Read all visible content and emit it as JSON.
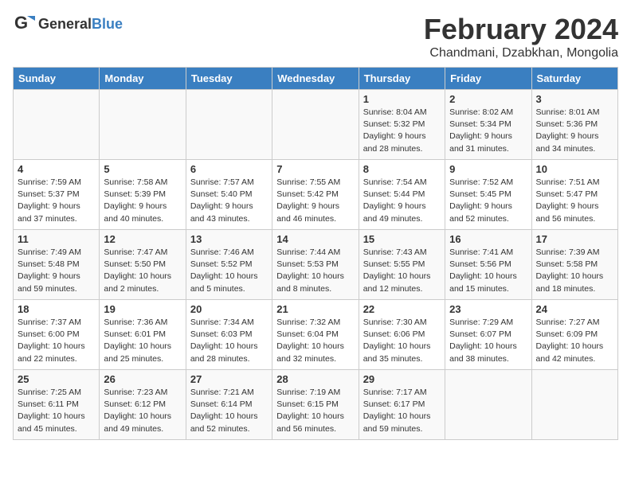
{
  "header": {
    "logo_general": "General",
    "logo_blue": "Blue",
    "main_title": "February 2024",
    "subtitle": "Chandmani, Dzabkhan, Mongolia"
  },
  "days_of_week": [
    "Sunday",
    "Monday",
    "Tuesday",
    "Wednesday",
    "Thursday",
    "Friday",
    "Saturday"
  ],
  "weeks": [
    [
      {
        "day": "",
        "info": ""
      },
      {
        "day": "",
        "info": ""
      },
      {
        "day": "",
        "info": ""
      },
      {
        "day": "",
        "info": ""
      },
      {
        "day": "1",
        "info": "Sunrise: 8:04 AM\nSunset: 5:32 PM\nDaylight: 9 hours\nand 28 minutes."
      },
      {
        "day": "2",
        "info": "Sunrise: 8:02 AM\nSunset: 5:34 PM\nDaylight: 9 hours\nand 31 minutes."
      },
      {
        "day": "3",
        "info": "Sunrise: 8:01 AM\nSunset: 5:36 PM\nDaylight: 9 hours\nand 34 minutes."
      }
    ],
    [
      {
        "day": "4",
        "info": "Sunrise: 7:59 AM\nSunset: 5:37 PM\nDaylight: 9 hours\nand 37 minutes."
      },
      {
        "day": "5",
        "info": "Sunrise: 7:58 AM\nSunset: 5:39 PM\nDaylight: 9 hours\nand 40 minutes."
      },
      {
        "day": "6",
        "info": "Sunrise: 7:57 AM\nSunset: 5:40 PM\nDaylight: 9 hours\nand 43 minutes."
      },
      {
        "day": "7",
        "info": "Sunrise: 7:55 AM\nSunset: 5:42 PM\nDaylight: 9 hours\nand 46 minutes."
      },
      {
        "day": "8",
        "info": "Sunrise: 7:54 AM\nSunset: 5:44 PM\nDaylight: 9 hours\nand 49 minutes."
      },
      {
        "day": "9",
        "info": "Sunrise: 7:52 AM\nSunset: 5:45 PM\nDaylight: 9 hours\nand 52 minutes."
      },
      {
        "day": "10",
        "info": "Sunrise: 7:51 AM\nSunset: 5:47 PM\nDaylight: 9 hours\nand 56 minutes."
      }
    ],
    [
      {
        "day": "11",
        "info": "Sunrise: 7:49 AM\nSunset: 5:48 PM\nDaylight: 9 hours\nand 59 minutes."
      },
      {
        "day": "12",
        "info": "Sunrise: 7:47 AM\nSunset: 5:50 PM\nDaylight: 10 hours\nand 2 minutes."
      },
      {
        "day": "13",
        "info": "Sunrise: 7:46 AM\nSunset: 5:52 PM\nDaylight: 10 hours\nand 5 minutes."
      },
      {
        "day": "14",
        "info": "Sunrise: 7:44 AM\nSunset: 5:53 PM\nDaylight: 10 hours\nand 8 minutes."
      },
      {
        "day": "15",
        "info": "Sunrise: 7:43 AM\nSunset: 5:55 PM\nDaylight: 10 hours\nand 12 minutes."
      },
      {
        "day": "16",
        "info": "Sunrise: 7:41 AM\nSunset: 5:56 PM\nDaylight: 10 hours\nand 15 minutes."
      },
      {
        "day": "17",
        "info": "Sunrise: 7:39 AM\nSunset: 5:58 PM\nDaylight: 10 hours\nand 18 minutes."
      }
    ],
    [
      {
        "day": "18",
        "info": "Sunrise: 7:37 AM\nSunset: 6:00 PM\nDaylight: 10 hours\nand 22 minutes."
      },
      {
        "day": "19",
        "info": "Sunrise: 7:36 AM\nSunset: 6:01 PM\nDaylight: 10 hours\nand 25 minutes."
      },
      {
        "day": "20",
        "info": "Sunrise: 7:34 AM\nSunset: 6:03 PM\nDaylight: 10 hours\nand 28 minutes."
      },
      {
        "day": "21",
        "info": "Sunrise: 7:32 AM\nSunset: 6:04 PM\nDaylight: 10 hours\nand 32 minutes."
      },
      {
        "day": "22",
        "info": "Sunrise: 7:30 AM\nSunset: 6:06 PM\nDaylight: 10 hours\nand 35 minutes."
      },
      {
        "day": "23",
        "info": "Sunrise: 7:29 AM\nSunset: 6:07 PM\nDaylight: 10 hours\nand 38 minutes."
      },
      {
        "day": "24",
        "info": "Sunrise: 7:27 AM\nSunset: 6:09 PM\nDaylight: 10 hours\nand 42 minutes."
      }
    ],
    [
      {
        "day": "25",
        "info": "Sunrise: 7:25 AM\nSunset: 6:11 PM\nDaylight: 10 hours\nand 45 minutes."
      },
      {
        "day": "26",
        "info": "Sunrise: 7:23 AM\nSunset: 6:12 PM\nDaylight: 10 hours\nand 49 minutes."
      },
      {
        "day": "27",
        "info": "Sunrise: 7:21 AM\nSunset: 6:14 PM\nDaylight: 10 hours\nand 52 minutes."
      },
      {
        "day": "28",
        "info": "Sunrise: 7:19 AM\nSunset: 6:15 PM\nDaylight: 10 hours\nand 56 minutes."
      },
      {
        "day": "29",
        "info": "Sunrise: 7:17 AM\nSunset: 6:17 PM\nDaylight: 10 hours\nand 59 minutes."
      },
      {
        "day": "",
        "info": ""
      },
      {
        "day": "",
        "info": ""
      }
    ]
  ]
}
